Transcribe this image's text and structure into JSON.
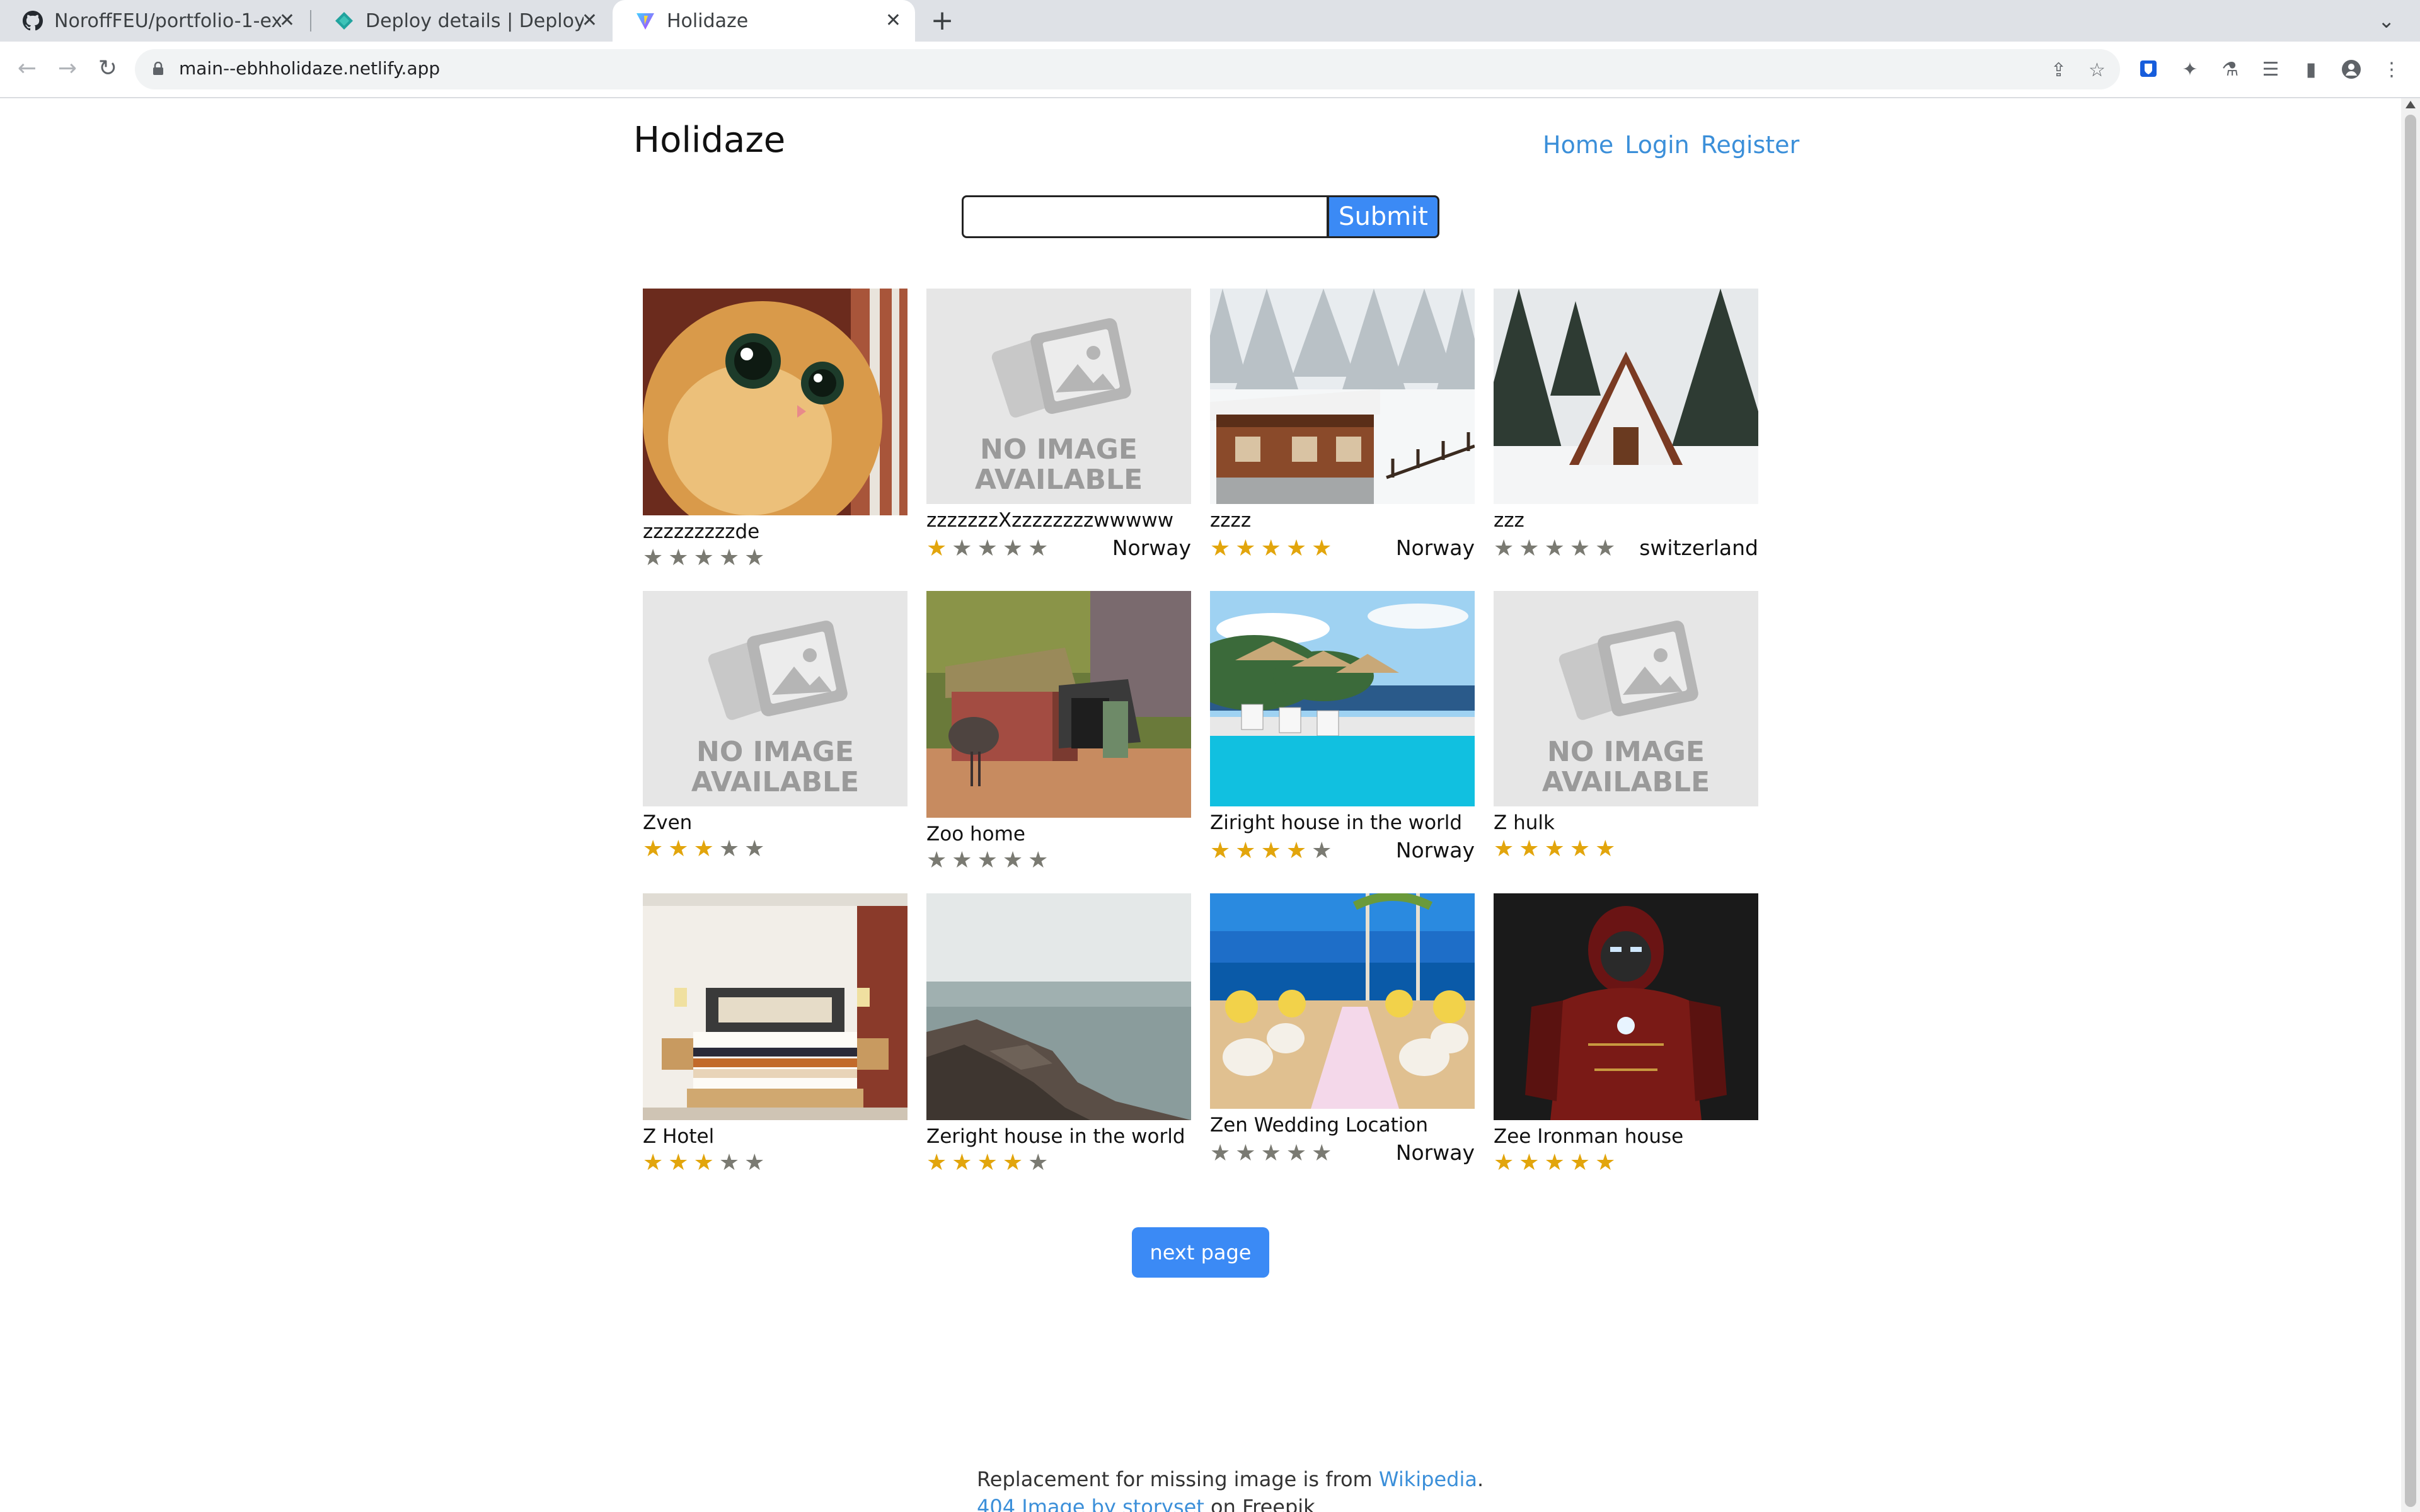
{
  "browser": {
    "tabs": [
      {
        "title": "NoroffFEU/portfolio-1-ex",
        "icon": "github-icon"
      },
      {
        "title": "Deploy details | Deploys |",
        "icon": "netlify-icon"
      },
      {
        "title": "Holidaze",
        "icon": "vite-icon"
      }
    ],
    "url": "main--ebhholidaze.netlify.app"
  },
  "site": {
    "title": "Holidaze",
    "nav": [
      "Home",
      "Login",
      "Register"
    ],
    "search": {
      "value": "",
      "submit_label": "Submit"
    }
  },
  "venues": [
    {
      "name": "zzzzzzzzzde",
      "rating": 0,
      "country": "",
      "image": "cat-photo"
    },
    {
      "name": "zzzzzzzXzzzzzzzzwwwww",
      "rating": 1,
      "country": "Norway",
      "image": "no-image"
    },
    {
      "name": "zzzz",
      "rating": 5,
      "country": "Norway",
      "image": "snowy-chalet"
    },
    {
      "name": "zzz",
      "rating": 0,
      "country": "switzerland",
      "image": "a-frame-cabin"
    },
    {
      "name": "Zven",
      "rating": 3,
      "country": "",
      "image": "no-image"
    },
    {
      "name": "Zoo home",
      "rating": 0,
      "country": "",
      "image": "emu-hut"
    },
    {
      "name": "Ziright house in the world",
      "rating": 4,
      "country": "Norway",
      "image": "pool-beach"
    },
    {
      "name": "Z hulk",
      "rating": 5,
      "country": "",
      "image": "no-image"
    },
    {
      "name": "Z Hotel",
      "rating": 3,
      "country": "",
      "image": "hotel-bedroom"
    },
    {
      "name": "Zeright house in the world",
      "rating": 4,
      "country": "",
      "image": "rocky-coast"
    },
    {
      "name": "Zen Wedding Location",
      "rating": 0,
      "country": "Norway",
      "image": "beach-wedding"
    },
    {
      "name": "Zee Ironman house",
      "rating": 5,
      "country": "",
      "image": "ironman"
    }
  ],
  "no_image_text": [
    "NO IMAGE",
    "AVAILABLE"
  ],
  "pagination": {
    "next_label": "next page"
  },
  "footer": {
    "line1_prefix": "Replacement for missing image is from ",
    "line1_link": "Wikipedia",
    "line1_suffix": ".",
    "line2_link": "404 Image by storyset",
    "line2_suffix": " on Freepik"
  },
  "colors": {
    "accent": "#3b8af5",
    "link": "#3b8fd9",
    "star_on": "#e2a50c",
    "star_off": "#7a7a72"
  }
}
